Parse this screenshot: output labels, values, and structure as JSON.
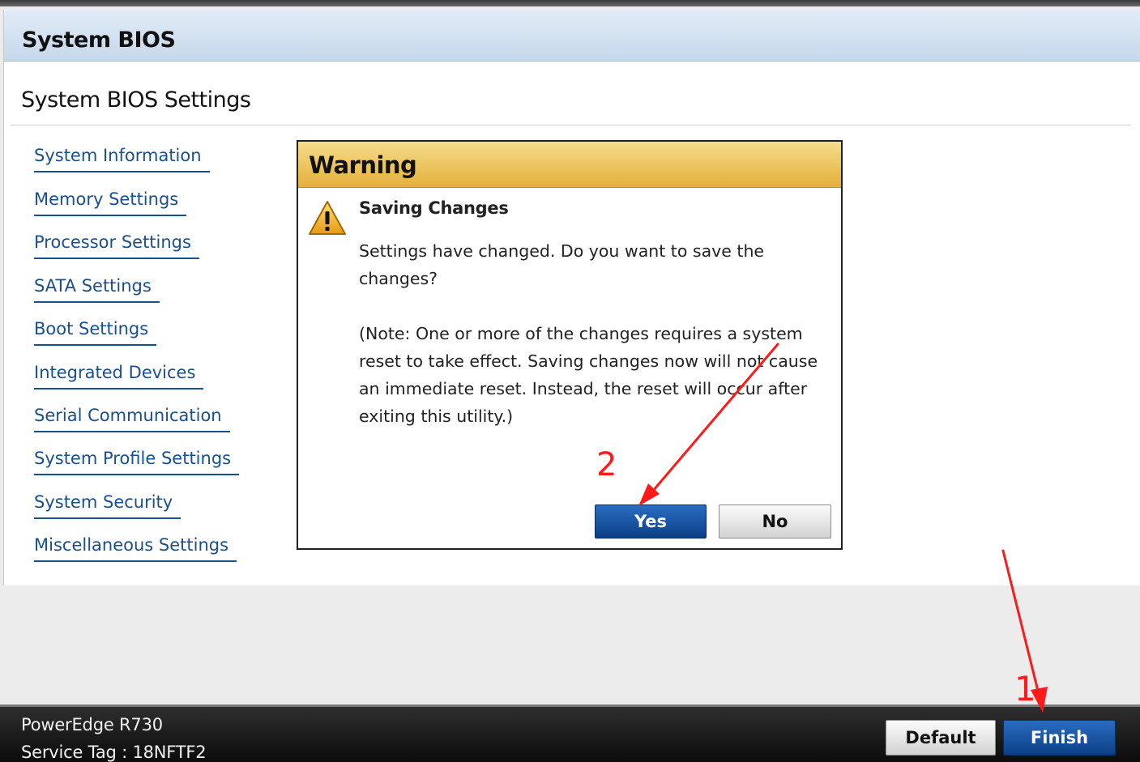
{
  "header": {
    "title": "System BIOS"
  },
  "page": {
    "title": "System BIOS Settings"
  },
  "nav": {
    "items": [
      {
        "label": "System Information"
      },
      {
        "label": "Memory Settings"
      },
      {
        "label": "Processor Settings"
      },
      {
        "label": "SATA Settings"
      },
      {
        "label": "Boot Settings"
      },
      {
        "label": "Integrated Devices"
      },
      {
        "label": "Serial Communication"
      },
      {
        "label": "System Profile Settings"
      },
      {
        "label": "System Security"
      },
      {
        "label": "Miscellaneous Settings"
      }
    ]
  },
  "dialog": {
    "title": "Warning",
    "heading": "Saving Changes",
    "message": "Settings have changed. Do you want to save the changes?",
    "note": "(Note: One or more of the changes requires a system reset to take effect. Saving changes now will not cause an immediate reset. Instead, the reset will occur after exiting this utility.)",
    "yes_label": "Yes",
    "no_label": "No",
    "icon": "warning-triangle-icon"
  },
  "footer": {
    "model": "PowerEdge R730",
    "service_tag": "Service Tag : 18NFTF2",
    "default_label": "Default",
    "finish_label": "Finish"
  },
  "annotations": {
    "step1": "1",
    "step2": "2"
  },
  "colors": {
    "accent": "#0b3f86",
    "link": "#1a4f8f",
    "warning_header": "#e4b03c",
    "annotation": "#ff1a1a"
  }
}
